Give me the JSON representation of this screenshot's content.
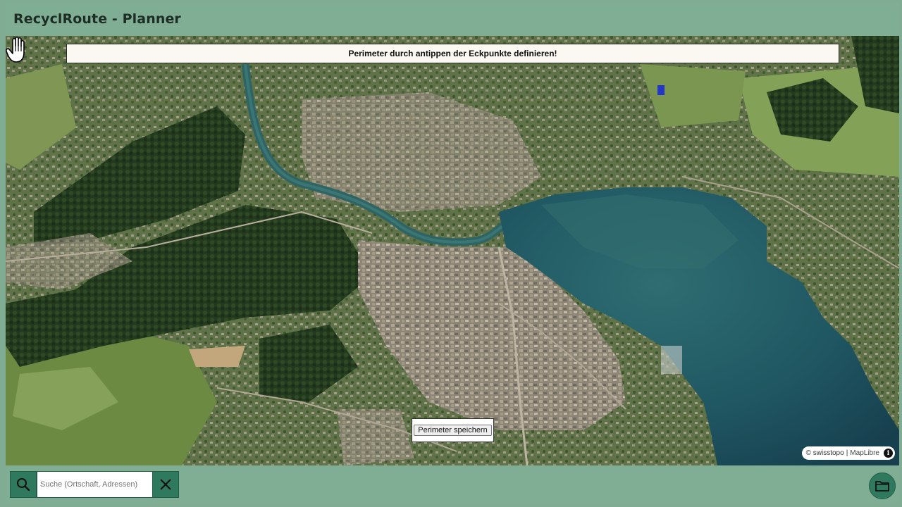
{
  "app": {
    "title": "RecyclRoute - Planner"
  },
  "map": {
    "instruction": "Perimeter durch antippen der Eckpunkte definieren!",
    "save_button_label": "Perimeter speichern",
    "attribution": {
      "source": "© swisstopo",
      "separator": "|",
      "library": "MapLibre",
      "info_glyph": "i"
    }
  },
  "search": {
    "placeholder": "Suche (Ortschaft, Adressen)",
    "value": ""
  },
  "icons": {
    "search": "search-icon",
    "clear": "close-icon",
    "folder": "folder-icon",
    "cursor": "hand-cursor-icon",
    "info": "info-icon"
  },
  "colors": {
    "accent": "#2f7a5e",
    "bar": "#80ae94",
    "water": "#1d5560"
  }
}
